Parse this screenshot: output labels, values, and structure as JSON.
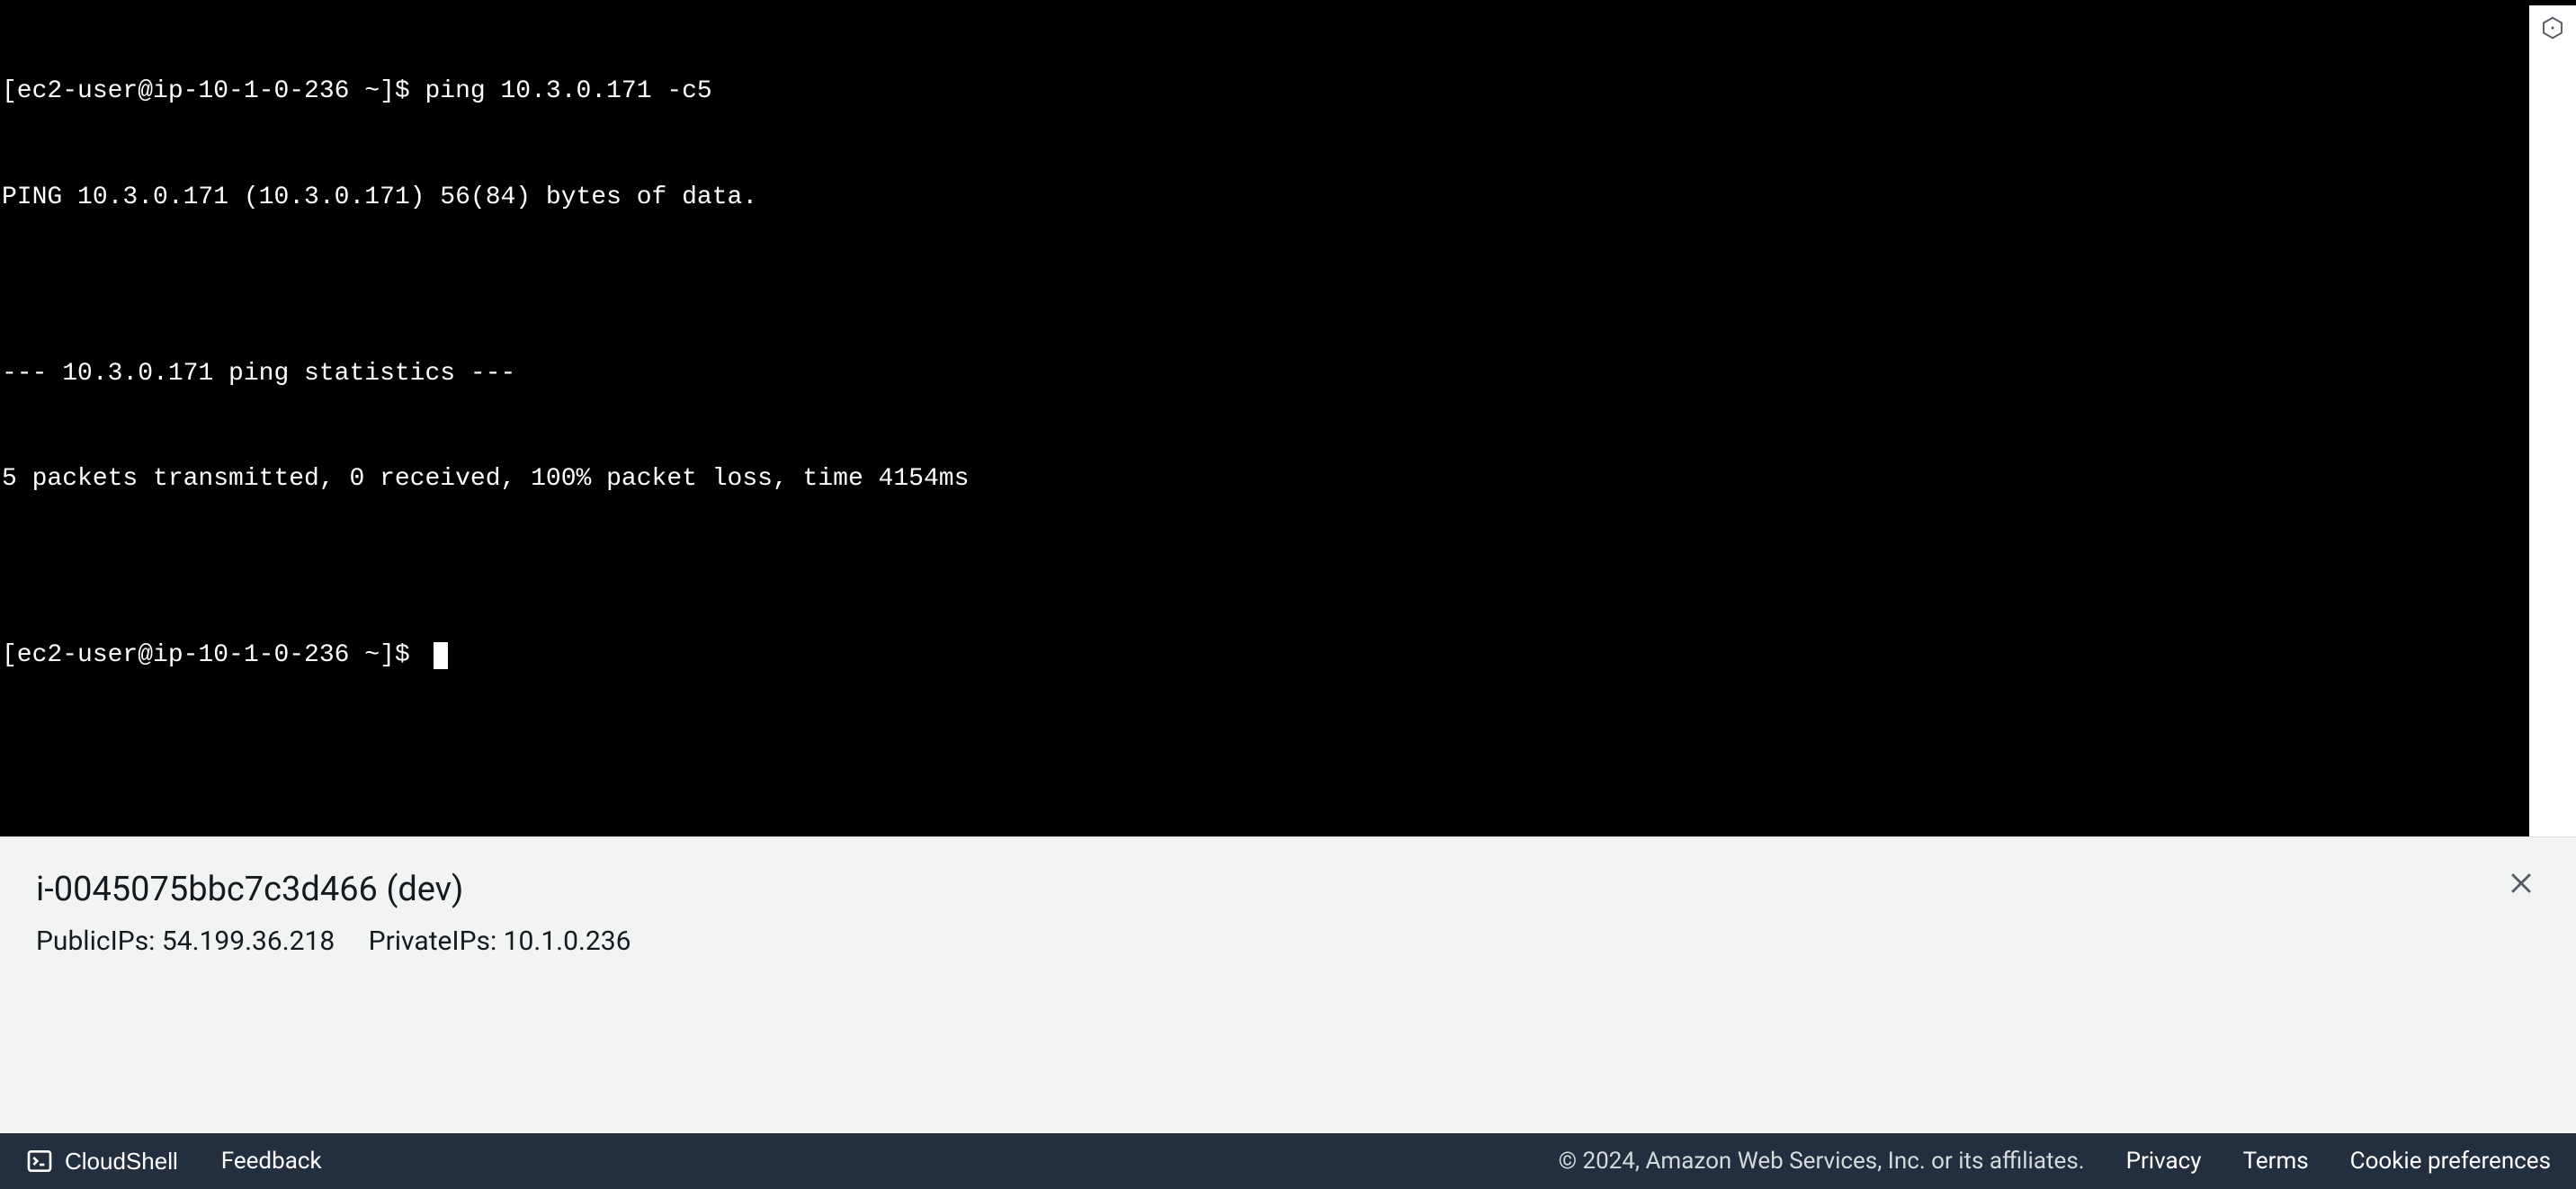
{
  "terminal": {
    "lines": [
      "[ec2-user@ip-10-1-0-236 ~]$ ping 10.3.0.171 -c5",
      "PING 10.3.0.171 (10.3.0.171) 56(84) bytes of data.",
      "",
      "--- 10.3.0.171 ping statistics ---",
      "5 packets transmitted, 0 received, 100% packet loss, time 4154ms",
      ""
    ],
    "prompt": "[ec2-user@ip-10-1-0-236 ~]$ "
  },
  "info_panel": {
    "title": "i-0045075bbc7c3d466 (dev)",
    "public_ips_label": "PublicIPs: 54.199.36.218",
    "private_ips_label": "PrivateIPs: 10.1.0.236"
  },
  "bottom_bar": {
    "cloudshell_label": "CloudShell",
    "feedback_label": "Feedback",
    "copyright": "© 2024, Amazon Web Services, Inc. or its affiliates.",
    "privacy": "Privacy",
    "terms": "Terms",
    "cookie_prefs": "Cookie preferences"
  }
}
